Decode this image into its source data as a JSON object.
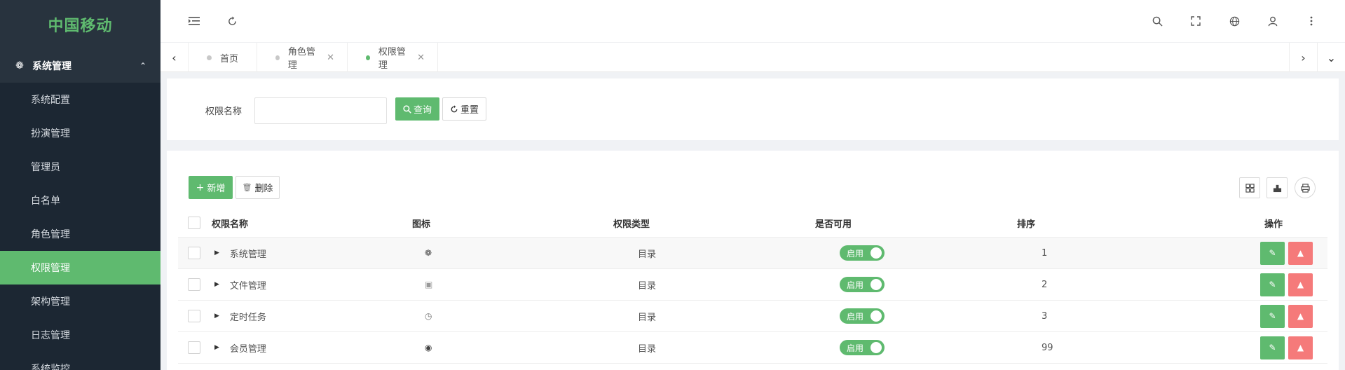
{
  "sidebar": {
    "brand": "中国移动",
    "group_label": "系统管理",
    "items": [
      {
        "label": "系统配置",
        "active": false
      },
      {
        "label": "扮演管理",
        "active": false
      },
      {
        "label": "管理员",
        "active": false
      },
      {
        "label": "白名单",
        "active": false
      },
      {
        "label": "角色管理",
        "active": false
      },
      {
        "label": "权限管理",
        "active": true
      },
      {
        "label": "架构管理",
        "active": false
      },
      {
        "label": "日志管理",
        "active": false
      },
      {
        "label": "系统监控",
        "active": false
      }
    ]
  },
  "tabs": [
    {
      "label": "首页",
      "closable": false,
      "active": false
    },
    {
      "label": "角色管理",
      "closable": true,
      "active": false
    },
    {
      "label": "权限管理",
      "closable": true,
      "active": true
    }
  ],
  "search": {
    "label": "权限名称",
    "value": "",
    "query_label": "查询",
    "reset_label": "重置"
  },
  "toolbar": {
    "add_label": "新增",
    "delete_label": "删除"
  },
  "table": {
    "headers": [
      "权限名称",
      "图标",
      "权限类型",
      "是否可用",
      "排序",
      "操作"
    ],
    "rows": [
      {
        "name": "系统管理",
        "icon": "gear-icon",
        "type": "目录",
        "status": "启用",
        "sort": "1"
      },
      {
        "name": "文件管理",
        "icon": "camera-icon",
        "type": "目录",
        "status": "启用",
        "sort": "2"
      },
      {
        "name": "定时任务",
        "icon": "clock-icon",
        "type": "目录",
        "status": "启用",
        "sort": "3"
      },
      {
        "name": "会员管理",
        "icon": "user-circle-icon",
        "type": "目录",
        "status": "启用",
        "sort": "99"
      }
    ]
  },
  "colors": {
    "accent": "#5fba6f",
    "danger": "#f57a7a",
    "sidebar_bg": "#1c2733"
  }
}
